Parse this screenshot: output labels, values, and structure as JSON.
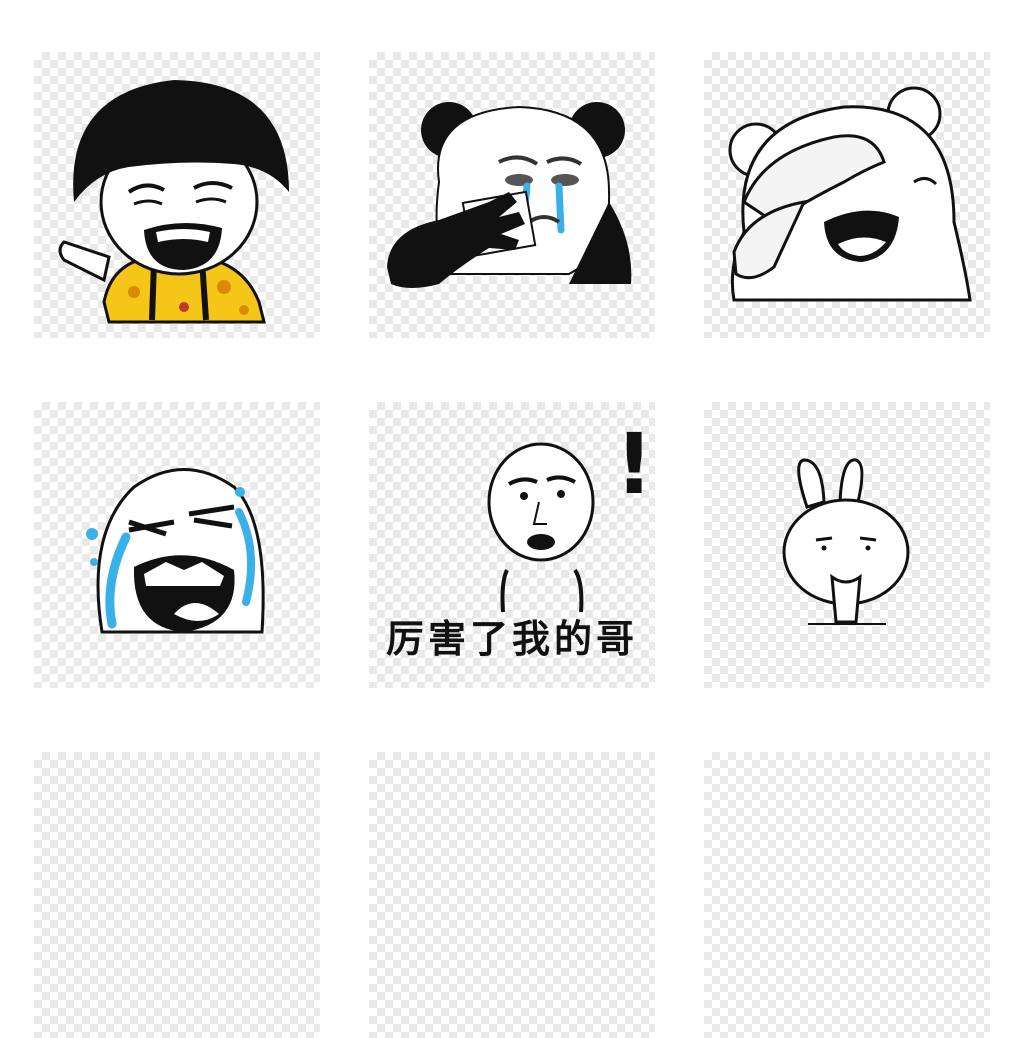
{
  "stickers": [
    {
      "icon": "mushroom-hair-crying-boy-icon"
    },
    {
      "icon": "crying-panda-icon"
    },
    {
      "icon": "laughing-bear-icon"
    },
    {
      "icon": "rage-face-crying-icon"
    },
    {
      "icon": "bald-man-exclaim-icon",
      "caption": "厉害了我的哥",
      "mark": "!"
    },
    {
      "icon": "bunny-icon"
    }
  ],
  "colors": {
    "checker_light": "#ffffff",
    "checker_dark": "#e9e9e9",
    "tear_blue": "#3ab0e8",
    "shirt_yellow": "#f5c518"
  }
}
